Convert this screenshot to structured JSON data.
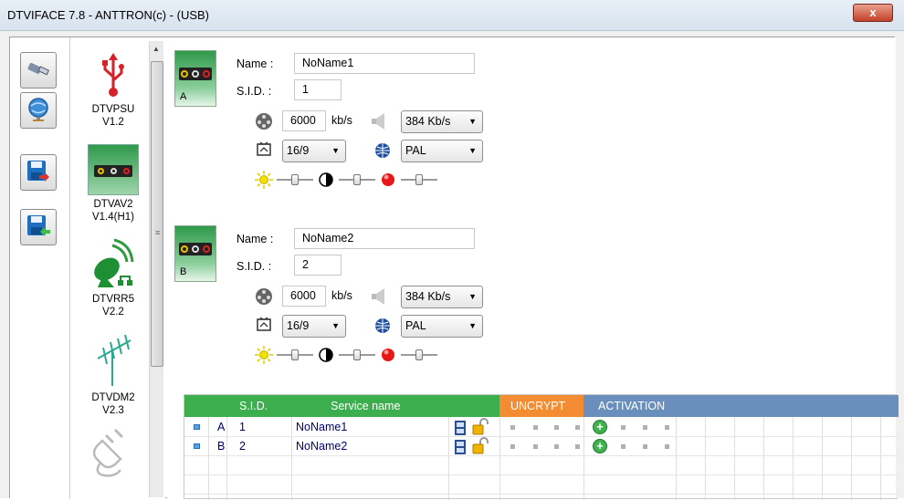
{
  "window": {
    "title": "DTVIFACE 7.8 - ANTTRON(c) - (USB)",
    "close_glyph": "x"
  },
  "toolbar": {
    "buttons": [
      {
        "icon": "usb-connection-icon"
      },
      {
        "icon": "network-globe-icon"
      },
      {
        "icon": "save-export-icon"
      },
      {
        "icon": "save-import-icon"
      }
    ]
  },
  "devices": [
    {
      "name": "DTVPSU",
      "version": "V1.2",
      "icon": "usb-icon"
    },
    {
      "name": "DTVAV2",
      "version": "V1.4(H1)",
      "icon": "av-module-icon"
    },
    {
      "name": "DTVRR5",
      "version": "V2.2",
      "icon": "satellite-dish-icon"
    },
    {
      "name": "DTVDM2",
      "version": "V2.3",
      "icon": "antenna-icon"
    },
    {
      "icon": "plug-icon"
    }
  ],
  "channels": [
    {
      "letter": "A",
      "name_label": "Name :",
      "name_value": "NoName1",
      "sid_label": "S.I.D. :",
      "sid_value": "1",
      "bitrate_value": "6000",
      "bitrate_unit": "kb/s",
      "audio_rate": "384 Kb/s",
      "aspect": "16/9",
      "standard": "PAL"
    },
    {
      "letter": "B",
      "name_label": "Name :",
      "name_value": "NoName2",
      "sid_label": "S.I.D. :",
      "sid_value": "2",
      "bitrate_value": "6000",
      "bitrate_unit": "kb/s",
      "audio_rate": "384 Kb/s",
      "aspect": "16/9",
      "standard": "PAL"
    }
  ],
  "table": {
    "headers": {
      "sid": "S.I.D.",
      "service_name": "Service name",
      "uncrypt": "UNCRYPT",
      "activation": "ACTIVATION"
    },
    "rows": [
      {
        "letter": "A",
        "sid": "1",
        "name": "NoName1"
      },
      {
        "letter": "B",
        "sid": "2",
        "name": "NoName2"
      }
    ]
  },
  "colors": {
    "green": "#3cae4e",
    "orange": "#f38c33",
    "blue": "#6a8fbd"
  }
}
